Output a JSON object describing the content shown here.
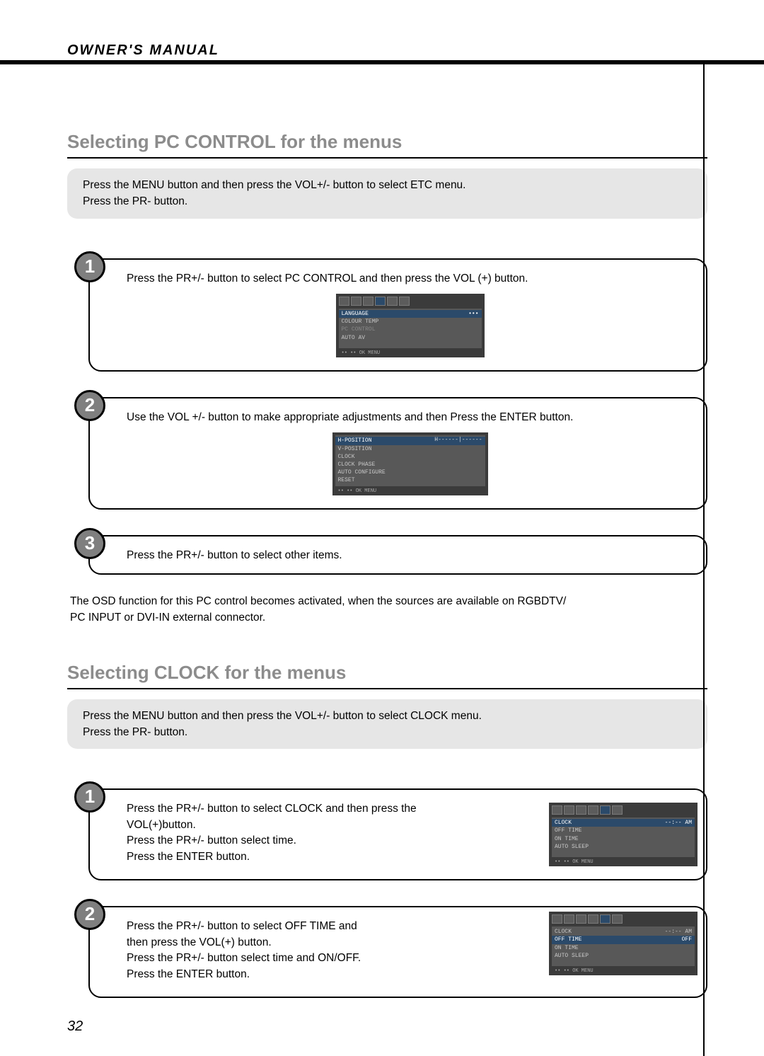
{
  "header": "OWNER'S MANUAL",
  "page_number": "32",
  "section1": {
    "title": "Selecting PC CONTROL for the menus",
    "intro_line1": "Press the MENU button and then press the VOL+/- button to select ETC menu.",
    "intro_line2": "Press the PR- button.",
    "step1_text": "Press the PR+/- button to select PC CONTROL and then press the VOL (+) button.",
    "step2_text": "Use the VOL +/- button to make appropriate adjustments and then Press the ENTER button.",
    "step3_text": "Press the PR+/- button to select other items.",
    "note_line1": "The OSD function for this PC control becomes activated, when the sources are available on RGBDTV/",
    "note_line2": "PC INPUT or DVI-IN external connector.",
    "osd1": {
      "rows": [
        {
          "l": "LANGUAGE",
          "r": "•••",
          "hl": true
        },
        {
          "l": "COLOUR TEMP",
          "r": ""
        },
        {
          "l": "PC CONTROL",
          "r": "",
          "dim": true
        },
        {
          "l": "AUTO AV",
          "r": ""
        }
      ],
      "foot": "•• •• OK MENU"
    },
    "osd2": {
      "rows": [
        {
          "l": "H-POSITION",
          "r": "",
          "hl": true
        },
        {
          "l": "V-POSITION",
          "r": ""
        },
        {
          "l": "CLOCK",
          "r": ""
        },
        {
          "l": "CLOCK PHASE",
          "r": ""
        },
        {
          "l": "AUTO CONFIGURE",
          "r": ""
        },
        {
          "l": "RESET",
          "r": ""
        }
      ],
      "slider_label": "H------|------",
      "foot": "•• •• OK MENU"
    }
  },
  "section2": {
    "title": "Selecting CLOCK for the menus",
    "intro_line1": "Press the MENU button and then press the VOL+/- button to select CLOCK menu.",
    "intro_line2": "Press the PR- button.",
    "step1_line1": "Press the PR+/- button to select CLOCK and then press the VOL(+)button.",
    "step1_line2": "Press the PR+/- button select time.",
    "step1_line3": "Press the ENTER button.",
    "step2_line1": "Press the PR+/- button to select OFF TIME and",
    "step2_line2": "then press the VOL(+) button.",
    "step2_line3": "Press the PR+/- button select time and ON/OFF.",
    "step2_line4": "Press the ENTER button.",
    "osd1": {
      "rows": [
        {
          "l": "CLOCK",
          "r": "--:-- AM",
          "hl": true
        },
        {
          "l": "OFF TIME",
          "r": ""
        },
        {
          "l": "ON TIME",
          "r": ""
        },
        {
          "l": "AUTO SLEEP",
          "r": ""
        }
      ],
      "foot": "•• •• OK MENU"
    },
    "osd2": {
      "rows": [
        {
          "l": "CLOCK",
          "r": "--:-- AM"
        },
        {
          "l": "OFF TIME",
          "r": "OFF",
          "hl": true
        },
        {
          "l": "ON TIME",
          "r": ""
        },
        {
          "l": "AUTO SLEEP",
          "r": ""
        }
      ],
      "foot": "•• •• OK MENU"
    }
  }
}
